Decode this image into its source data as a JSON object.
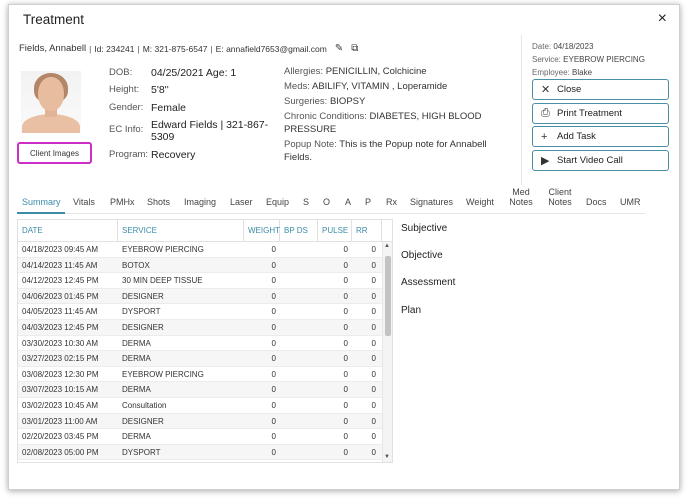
{
  "dialog": {
    "title": "Treatment",
    "close_label": "×"
  },
  "patient": {
    "name": "Fields, Annabell",
    "id_text": "Id: 234241",
    "mobile_text": "M: 321-875-6547",
    "email_text": "E: annafield7653@gmail.com",
    "separator": "|",
    "edit_icon_glyph": "✎",
    "video_icon_glyph": "⧉"
  },
  "client_images_label": "Client Images",
  "info": {
    "labels": [
      "DOB:",
      "Height:",
      "Gender:",
      "EC Info:",
      "Program:"
    ],
    "dob": "04/25/2021 Age: 1",
    "height": "5'8''",
    "gender": "Female",
    "ec_info": "Edward Fields | 321-867-5309",
    "program": "Recovery"
  },
  "medical": {
    "allergies_label": "Allergies:",
    "allergies": "PENICILLIN, Colchicine",
    "meds_label": "Meds:",
    "meds": "ABILIFY, VITAMIN , Loperamide",
    "surgeries_label": "Surgeries:",
    "surgeries": "BIOPSY",
    "chronic_label": "Chronic Conditions:",
    "chronic": "DIABETES, HIGH BLOOD PRESSURE",
    "popup_label": "Popup Note:",
    "popup": "This is the Popup note for Annabell Fields."
  },
  "meta": {
    "date_label": "Date:",
    "date": "04/18/2023",
    "service_label": "Service:",
    "service": "EYEBROW PIERCING",
    "employee_label": "Employee:",
    "employee": "Blake"
  },
  "actions": {
    "close": {
      "label": "Close",
      "glyph": "✕"
    },
    "print": {
      "label": "Print Treatment",
      "glyph": "⎙"
    },
    "add_task": {
      "label": "Add Task",
      "glyph": "+"
    },
    "video": {
      "label": "Start Video Call",
      "glyph": "▶"
    }
  },
  "tabs": [
    "Summary",
    "Vitals",
    "PMHx",
    "Shots",
    "Imaging",
    "Laser",
    "Equip",
    "S",
    "O",
    "A",
    "P",
    "Rx",
    "Signatures",
    "Weight",
    "Med Notes",
    "Client Notes",
    "Docs",
    "UMR"
  ],
  "table": {
    "headers": [
      "DATE",
      "SERVICE",
      "WEIGHT",
      "BP DS",
      "PULSE",
      "RR"
    ],
    "rows": [
      [
        "04/18/2023 09:45 AM",
        "EYEBROW PIERCING",
        "0",
        "",
        "0",
        "0"
      ],
      [
        "04/14/2023 11:45 AM",
        "BOTOX",
        "0",
        "",
        "0",
        "0"
      ],
      [
        "04/12/2023 12:45 PM",
        "30 MIN DEEP TISSUE",
        "0",
        "",
        "0",
        "0"
      ],
      [
        "04/06/2023 01:45 PM",
        "DESIGNER",
        "0",
        "",
        "0",
        "0"
      ],
      [
        "04/05/2023 11:45 AM",
        "DYSPORT",
        "0",
        "",
        "0",
        "0"
      ],
      [
        "04/03/2023 12:45 PM",
        "DESIGNER",
        "0",
        "",
        "0",
        "0"
      ],
      [
        "03/30/2023 10:30 AM",
        "DERMA",
        "0",
        "",
        "0",
        "0"
      ],
      [
        "03/27/2023 02:15 PM",
        "DERMA",
        "0",
        "",
        "0",
        "0"
      ],
      [
        "03/08/2023 12:30 PM",
        "EYEBROW PIERCING",
        "0",
        "",
        "0",
        "0"
      ],
      [
        "03/07/2023 10:15 AM",
        "DERMA",
        "0",
        "",
        "0",
        "0"
      ],
      [
        "03/02/2023 10:45 AM",
        "Consultation",
        "0",
        "",
        "0",
        "0"
      ],
      [
        "03/01/2023 11:00 AM",
        "DESIGNER",
        "0",
        "",
        "0",
        "0"
      ],
      [
        "02/20/2023 03:45 PM",
        "DERMA",
        "0",
        "",
        "0",
        "0"
      ],
      [
        "02/08/2023 05:00 PM",
        "DYSPORT",
        "0",
        "",
        "0",
        "0"
      ]
    ]
  },
  "soap": [
    "Subjective",
    "Objective",
    "Assessment",
    "Plan"
  ]
}
